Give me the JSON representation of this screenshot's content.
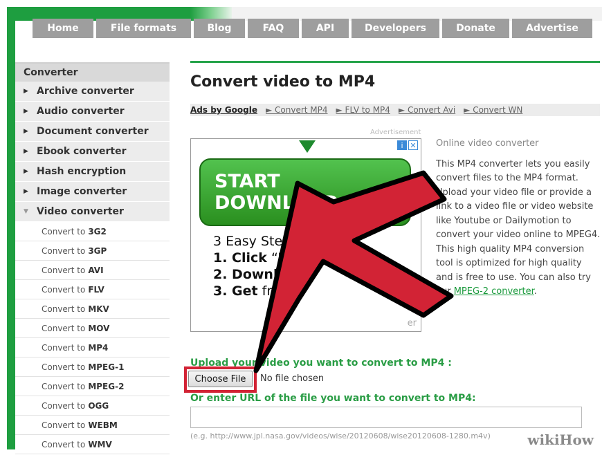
{
  "nav": {
    "items": [
      "Home",
      "File formats",
      "Blog",
      "FAQ",
      "API",
      "Developers",
      "Donate",
      "Advertise"
    ]
  },
  "sidebar": {
    "heading": "Converter",
    "categories": [
      "Archive converter",
      "Audio converter",
      "Document converter",
      "Ebook converter",
      "Hash encryption",
      "Image converter",
      "Video converter"
    ],
    "sub_prefix": "Convert to",
    "sub_items": [
      "3G2",
      "3GP",
      "AVI",
      "FLV",
      "MKV",
      "MOV",
      "MP4",
      "MPEG-1",
      "MPEG-2",
      "OGG",
      "WEBM",
      "WMV"
    ]
  },
  "main": {
    "title": "Convert video to MP4",
    "ads_by": "Ads by Google",
    "ad_links": [
      "► Convert MP4",
      "► FLV to MP4",
      "► Convert Avi",
      "► Convert WN"
    ],
    "advertisement_label": "Advertisement",
    "ad": {
      "button": "START DOWNLOAD",
      "step_header": "3 Easy Steps:",
      "step1_bold": "1. Click",
      "step1_rest": " “Dov",
      "step2_bold": "2. Downloa",
      "step3_bold": "3. Get",
      "step3_rest": " free",
      "footer": "er"
    },
    "info": {
      "title": "Online video converter",
      "body": "This MP4 converter lets you easily convert files to the MP4 format. Upload your video file or provide a link to a video file or video website like Youtube or Dailymotion to convert your video online to MPEG4. This high quality MP4 conversion tool is optimized for high quality and is free to use. You can also try our",
      "link": "MPEG-2 converter",
      "end": "."
    },
    "upload": {
      "label": "Upload your video you want to convert to MP4 :",
      "button": "Choose File",
      "no_file": "No file chosen",
      "url_label": "Or enter URL of the file you want to convert to MP4:",
      "url_value": "",
      "url_hint": "(e.g. http://www.jpl.nasa.gov/videos/wise/20120608/wise20120608-1280.m4v)"
    }
  },
  "watermark": {
    "wiki": "wiki",
    "how": "How"
  },
  "colors": {
    "brand_green": "#1e9e40",
    "nav_gray": "#9e9e9e",
    "annotation_red": "#d22335"
  }
}
